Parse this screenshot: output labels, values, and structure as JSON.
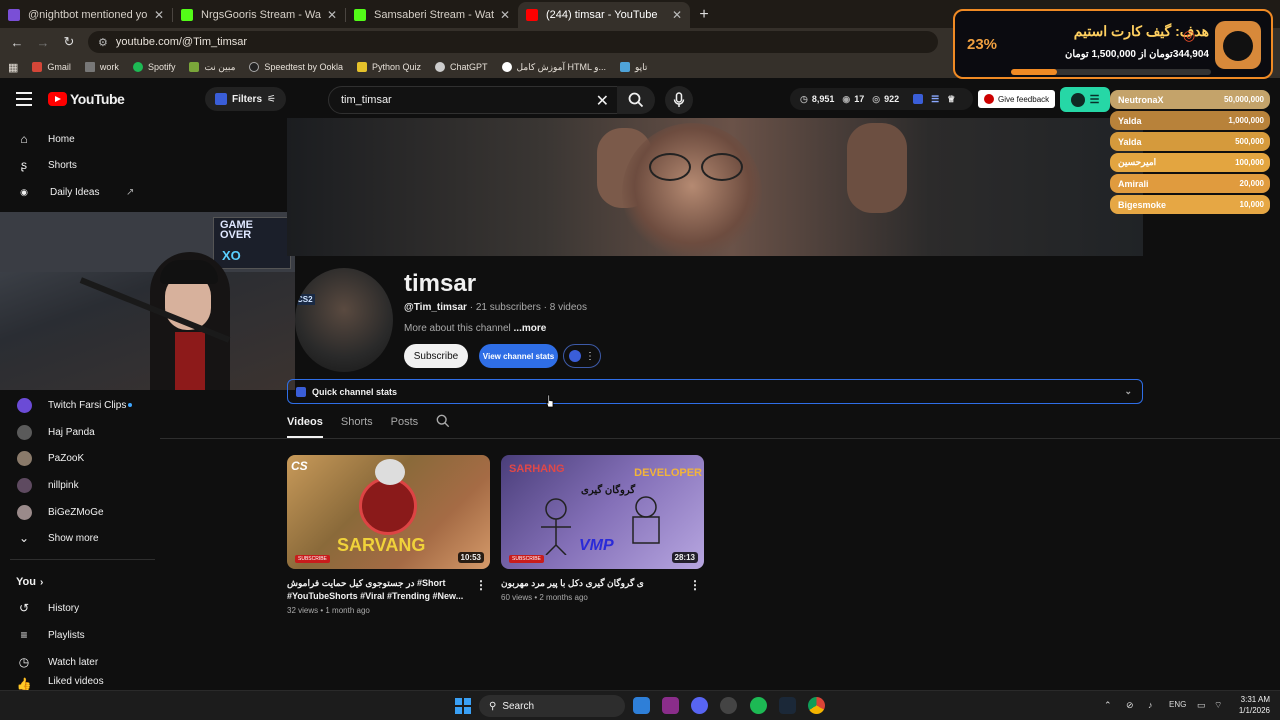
{
  "browser": {
    "tabs": [
      {
        "title": "@nightbot mentioned you",
        "color": "#7a4fd6",
        "active": false
      },
      {
        "title": "NrgsGooris Stream - Watch Live",
        "color": "#53fc18",
        "active": false
      },
      {
        "title": "Samsaberi Stream - Watch Live",
        "color": "#53fc18",
        "active": false
      },
      {
        "title": "(244) timsar - YouTube",
        "color": "#ff0000",
        "active": true
      }
    ],
    "url": "youtube.com/@Tim_timsar",
    "bookmarks": [
      "Gmail",
      "work",
      "Spotify",
      "مبین نت",
      "Speedtest by Ookla",
      "Python Quiz",
      "ChatGPT",
      "آموزش کامل HTML و...",
      "تاپو"
    ]
  },
  "header": {
    "logo": "YouTube",
    "filters_label": "Filters",
    "search_value": "tim_timsar",
    "stats": [
      "8,951",
      "17",
      "922"
    ],
    "feedback_label": "Give feedback"
  },
  "sidebar": {
    "main": [
      "Home",
      "Shorts",
      "Daily Ideas"
    ],
    "subscriptions": [
      "Twitch Farsi Clips",
      "Haj Panda",
      "PaZooK",
      "nillpink",
      "BiGeZMoGe"
    ],
    "show_more": "Show more",
    "you_label": "You",
    "you_items": [
      "History",
      "Playlists",
      "Watch later",
      "Liked videos"
    ]
  },
  "webcam": {
    "sign_line1": "GAME",
    "sign_line2": "OVER",
    "sign_logo": "XO"
  },
  "channel": {
    "name": "timsar",
    "handle": "@Tim_timsar",
    "meta": "· 21 subscribers · 8 videos",
    "more_text": "More about this channel",
    "more_link": "...more",
    "subscribe_label": "Subscribe",
    "stats_button": "View channel stats",
    "avatar_badge": "CS2",
    "quick_stats": "Quick channel stats",
    "tabs": [
      "Videos",
      "Shorts",
      "Posts"
    ]
  },
  "videos": [
    {
      "title": "در جستوجوی کیل حمایت فراموش #Short #YouTubeShorts #Viral #Trending #New...",
      "meta": "32 views • 1 month ago",
      "duration": "10:53",
      "badge": "SUBSCRIBE",
      "thumb_text": "SARVANG",
      "thumb_corner": "CS"
    },
    {
      "title": "ی گروگان گیری دکل با پیر مرد مهربون",
      "meta": "60 views • 2 months ago",
      "duration": "28:13",
      "badge": "SUBSCRIBE",
      "thumb_text": "SARHANG",
      "thumb_text2": "DEVELOPER",
      "thumb_caption": "گروگان گیری",
      "thumb_corner": "VMP"
    }
  ],
  "goal": {
    "percent_label": "23%",
    "progress": 0.23,
    "title": "هدف: گیف کارت استیم",
    "amount": "344,904تومان از 1,500,000 تومان"
  },
  "leaderboard": [
    {
      "name": "NeutronaX",
      "amount": "50,000,000",
      "color": "#c4a36a"
    },
    {
      "name": "Yalda",
      "amount": "1,000,000",
      "color": "#b8823a"
    },
    {
      "name": "Yalda",
      "amount": "500,000",
      "color": "#d59a3c"
    },
    {
      "name": "امیرحسین",
      "amount": "100,000",
      "color": "#e3a540"
    },
    {
      "name": "Amirali",
      "amount": "20,000",
      "color": "#e09b3e"
    },
    {
      "name": "Bigesmoke",
      "amount": "10,000",
      "color": "#e6a744"
    }
  ],
  "taskbar": {
    "search_label": "Search",
    "lang": "ENG",
    "time": "3:31 AM",
    "date": "1/1/2026"
  }
}
